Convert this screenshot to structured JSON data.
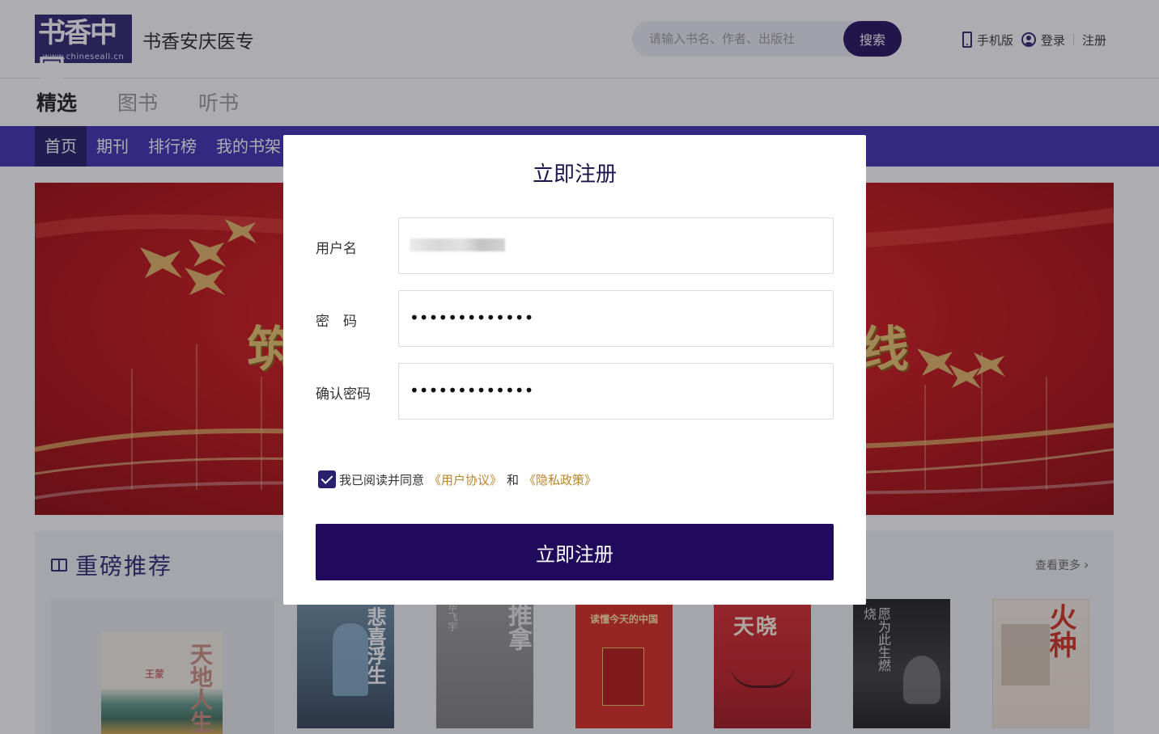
{
  "header": {
    "logo_text": "书香中国",
    "logo_url": "www.chineseall.cn",
    "site_name": "书香安庆医专",
    "search_placeholder": "请输入书名、作者、出版社",
    "search_button": "搜索",
    "mobile_link": "手机版",
    "login_link": "登录",
    "register_link": "注册"
  },
  "category_tabs": [
    {
      "label": "精选",
      "active": true
    },
    {
      "label": "图书",
      "active": false
    },
    {
      "label": "听书",
      "active": false
    }
  ],
  "nav": {
    "items": [
      {
        "label": "首页",
        "active": true
      },
      {
        "label": "期刊",
        "active": false
      },
      {
        "label": "排行榜",
        "active": false
      },
      {
        "label": "我的书架",
        "active": false
      }
    ]
  },
  "banner": {
    "left_char": "筑",
    "right_char": "线"
  },
  "recommend": {
    "title": "重磅推荐",
    "more_label": "查看更多",
    "books": [
      {
        "title": "天地人生",
        "author": "王蒙"
      },
      {
        "title": "悲喜浮生",
        "author": ""
      },
      {
        "title": "推拿",
        "author": "毕飞宇"
      },
      {
        "title": "读懂今天的中国",
        "author": ""
      },
      {
        "title": "天晓",
        "author": ""
      },
      {
        "title": "愿为此生燃烧",
        "author": ""
      },
      {
        "title": "火种",
        "author": ""
      }
    ]
  },
  "modal": {
    "title": "立即注册",
    "username_label": "用户名",
    "password_label": "密　码",
    "confirm_label": "确认密码",
    "password_mask": "•••••••••••••",
    "confirm_mask": "•••••••••••••",
    "agree_text": "我已阅读并同意",
    "user_agreement": "《用户协议》",
    "and_text": "和",
    "privacy_policy": "《隐私政策》",
    "submit_label": "立即注册",
    "agree_checked": true
  },
  "colors": {
    "primary": "#200a5c",
    "nav_bg": "#3a2bb0",
    "link_gold": "#b8862d",
    "banner_red": "#c90f12"
  }
}
